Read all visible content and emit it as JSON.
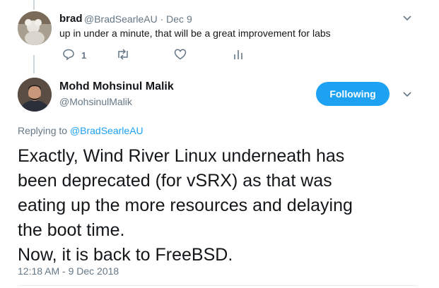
{
  "reply_tweet": {
    "name": "brad",
    "handle": "@BradSearleAU",
    "separator": "·",
    "date": "Dec 9",
    "text": "up in under a minute, that will be a great improvement for labs",
    "reply_count": "1",
    "icons": [
      "reply-icon",
      "retweet-icon",
      "like-icon",
      "analytics-icon",
      "chevron-down-icon"
    ]
  },
  "main_tweet": {
    "name": "Mohd Mohsinul Malik",
    "handle": "@MohsinulMalik",
    "follow_label": "Following",
    "replying_prefix": "Replying to",
    "replying_handle": "@BradSearleAU",
    "lines": [
      "Exactly, Wind River Linux underneath has",
      "been deprecated (for vSRX) as that was",
      "eating up the more resources and delaying",
      "the boot time.",
      "Now, it is back to FreeBSD."
    ],
    "timestamp": "12:18 AM - 9 Dec 2018"
  },
  "colors": {
    "accent": "#1da1f2",
    "muted": "#657786",
    "text": "#14171a"
  }
}
